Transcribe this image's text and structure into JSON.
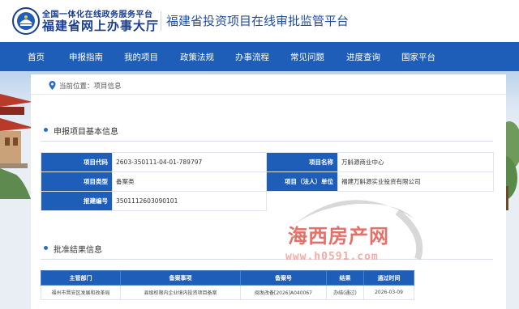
{
  "header": {
    "logo_small": "全国一体化在线政务服务平台",
    "logo_big": "福建省网上办事大厅",
    "site_title": "福建省投资项目在线审批监管平台"
  },
  "nav": {
    "items": [
      "首页",
      "申报指南",
      "我的项目",
      "政策法规",
      "办事流程",
      "常见问题",
      "进度查询",
      "国家平台"
    ]
  },
  "breadcrumb": {
    "text": "当前位置：项目信息"
  },
  "basic_section": {
    "title": "申报项目基本信息",
    "rows": [
      {
        "label1": "项目代码",
        "value1": "2603-350111-04-01-789797",
        "label2": "项目名称",
        "value2": "万斛源商业中心"
      },
      {
        "label1": "项目类型",
        "value1": "备案类",
        "label2": "项目（法人）单位",
        "value2": "福建万斛源实业投资有限公司"
      },
      {
        "label1": "报建编号",
        "value1": "3501112603090101",
        "label2": "",
        "value2": ""
      }
    ]
  },
  "result_section": {
    "title": "批准结果信息",
    "headers": [
      "主管部门",
      "备案事项",
      "备案号",
      "结果",
      "通过时间"
    ],
    "rows": [
      [
        "福州市晋安区发展和改革局",
        "县级权限内企业境内投资项目备案",
        "闽发改备[2026]A040067",
        "办结(通过)",
        "2026-03-09"
      ]
    ]
  },
  "watermark": {
    "brand": "海西房产网",
    "url": "www.h0591.com"
  },
  "colors": {
    "nav_bg": "#1e5eb8",
    "label_bg": "#1e5eb8",
    "title_blue": "#1f4ea3",
    "watermark_red": "#e0584e"
  },
  "icons": {
    "logo": "government-emblem-icon",
    "breadcrumb": "location-pin-icon",
    "section": "section-bullet-icon"
  }
}
